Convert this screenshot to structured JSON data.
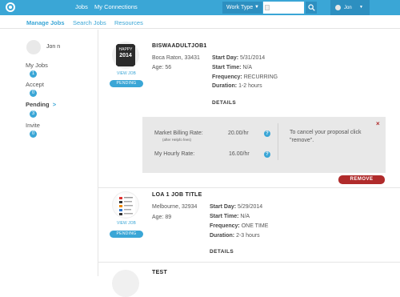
{
  "topbar": {
    "nav_jobs": "Jobs",
    "nav_connections": "My Connections",
    "filter_label": "Work Type",
    "search_placeholder": "",
    "user_name": "Jon"
  },
  "subnav": {
    "manage_jobs": "Manage Jobs",
    "search_jobs": "Search Jobs",
    "resources": "Resources"
  },
  "sidebar": {
    "user_name": "Jon n",
    "items": [
      {
        "label": "My Jobs",
        "count": "1"
      },
      {
        "label": "Accept",
        "count": "0"
      },
      {
        "label": "Pending",
        "count": "3",
        "arrow": ">"
      },
      {
        "label": "Invite",
        "count": "0"
      }
    ]
  },
  "jobs": [
    {
      "title": "BISWAADULTJOB1",
      "thumb_text_top": "HAPPY",
      "thumb_text_big": "2014",
      "view_job": "VIEW JOB",
      "status": "PENDING",
      "location": "Boca Raton, 33431",
      "age": "Age: 56",
      "start_day_label": "Start Day:",
      "start_day": "5/31/2014",
      "start_time_label": "Start Time:",
      "start_time": "N/A",
      "frequency_label": "Frequency:",
      "frequency": "RECURRING",
      "duration_label": "Duration:",
      "duration": "1-2 hours",
      "details": "DETAILS"
    },
    {
      "title": "LOA 1 JOB TITLE",
      "view_job": "VIEW JOB",
      "status": "PENDING",
      "location": "Melbourne, 32934",
      "age": "Age: 89",
      "start_day_label": "Start Day:",
      "start_day": "5/29/2014",
      "start_time_label": "Start Time:",
      "start_time": "N/A",
      "frequency_label": "Frequency:",
      "frequency": "ONE TIME",
      "duration_label": "Duration:",
      "duration": "2-3 hours",
      "details": "DETAILS"
    },
    {
      "title": "TEST"
    }
  ],
  "proposal": {
    "market_rate_label": "Market Billing Rate:",
    "market_rate_note": "(after Helpfo fees)",
    "market_rate": "20.00/hr",
    "my_rate_label": "My Hourly Rate:",
    "my_rate": "16.00/hr",
    "help_glyph": "?",
    "cancel_text_1": "To cancel your proposal click",
    "cancel_text_2": "\"remove\".",
    "close_glyph": "×",
    "remove_label": "REMOVE"
  },
  "colors": {
    "accent": "#3aa6d6",
    "accent_dark": "#2d8fc0",
    "danger": "#b02b2b",
    "panel": "#e8e8e8"
  }
}
